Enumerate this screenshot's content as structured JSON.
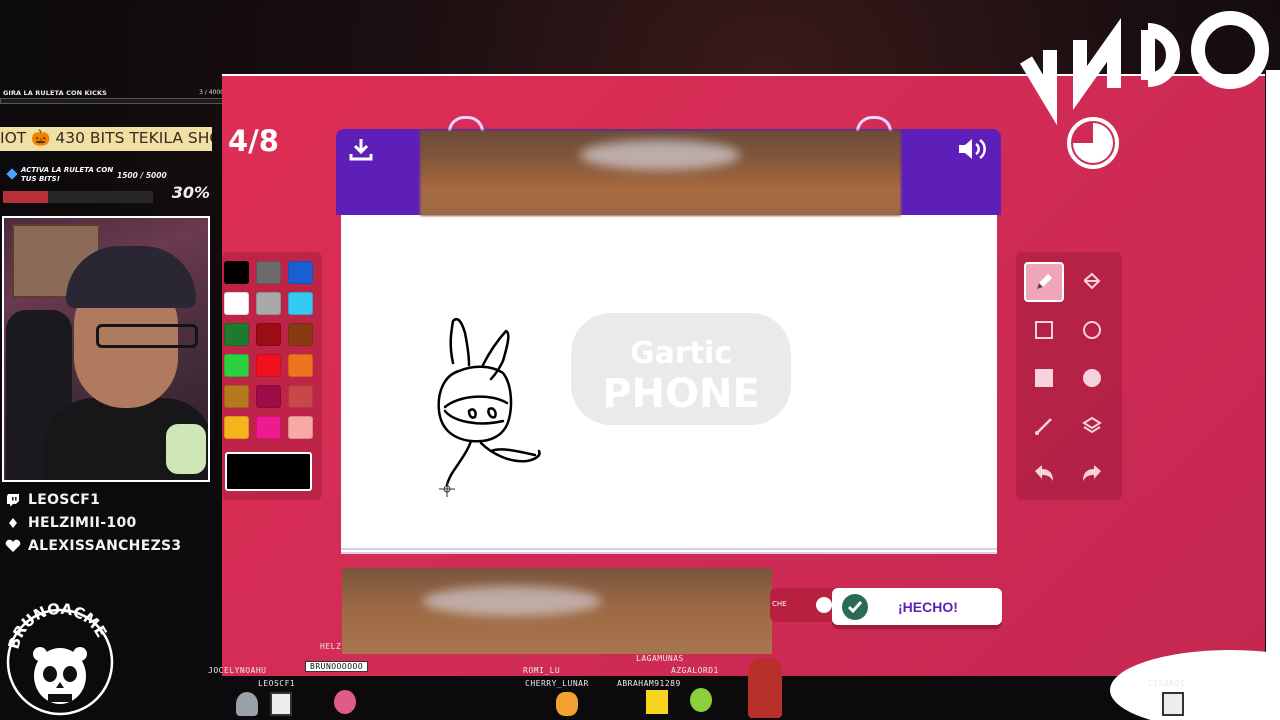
{
  "overlay": {
    "roulette": {
      "title": "GIRA LA RULETA CON KICKS",
      "count": "3 / 4000"
    },
    "ticker": "IOT 🎃 430 BITS TEKILA SHO",
    "bits": {
      "text": "ACTIVA LA RULETA CON TUS BITS!",
      "count": "1500 / 5000",
      "percent": "30%",
      "progress": 0.3
    },
    "socials": [
      {
        "icon": "twitch-icon",
        "name": "LEOSCF1"
      },
      {
        "icon": "kick-icon",
        "name": "HELZIMII-100"
      },
      {
        "icon": "heart-icon",
        "name": "ALEXISSANCHEZS3"
      }
    ],
    "brand": "BRUNOACME"
  },
  "game": {
    "round": "4/8",
    "done_label": "¡HECHO!",
    "toggle_label": "CHE",
    "canvas_watermark": [
      "Gartic",
      "PHONE"
    ],
    "colors": {
      "background": "#d52c55",
      "board": "#5d1fb8",
      "accent": "#5d1fb8"
    },
    "palette": [
      "#000000",
      "#6b6b6b",
      "#1a5fd1",
      "#ffffff",
      "#a8a8a8",
      "#33c9f0",
      "#1d7a2e",
      "#9b0d12",
      "#8a3a12",
      "#2ccf3d",
      "#f2101d",
      "#f0731e",
      "#b57a1e",
      "#9e0c47",
      "#c9474b",
      "#f6b31e",
      "#ef1a8d",
      "#f8a9a5"
    ],
    "current_color": "#000000",
    "tools": [
      {
        "name": "pencil-icon",
        "active": true
      },
      {
        "name": "bucket-icon",
        "active": false
      },
      {
        "name": "square-outline-icon",
        "active": false
      },
      {
        "name": "circle-outline-icon",
        "active": false
      },
      {
        "name": "square-filled-icon",
        "active": false
      },
      {
        "name": "circle-filled-icon",
        "active": false
      },
      {
        "name": "line-icon",
        "active": false
      },
      {
        "name": "layer-icon",
        "active": false
      },
      {
        "name": "undo-icon",
        "active": false
      },
      {
        "name": "redo-icon",
        "active": false
      }
    ]
  },
  "chat": {
    "names": [
      "JOCELYNOAHU",
      "BRUNOOOOOO",
      "LEOSCF1",
      "HELZ",
      "ROMI_LU",
      "CHERRY_LUNAR",
      "LAGAMUNAS",
      "ABRAHAM91289",
      "AZGALORD1",
      "CISAROI"
    ]
  }
}
